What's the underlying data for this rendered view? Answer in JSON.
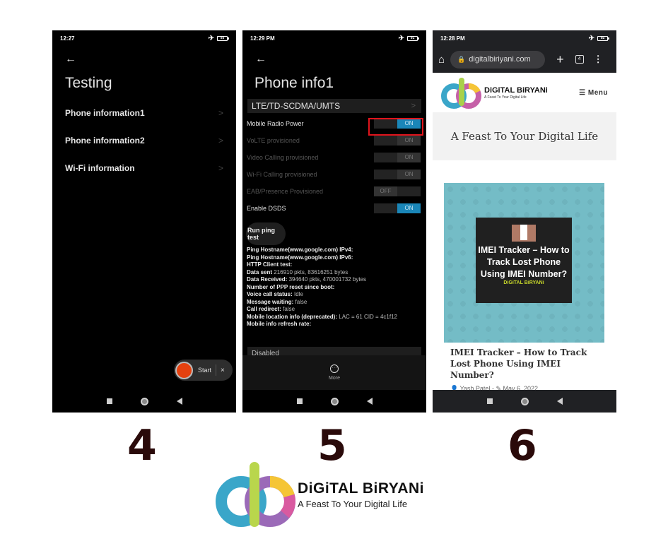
{
  "screens": {
    "testing": {
      "status_time": "12:27",
      "battery": "93",
      "title": "Testing",
      "items": [
        {
          "label": "Phone information1"
        },
        {
          "label": "Phone information2"
        },
        {
          "label": "Wi-Fi information"
        }
      ],
      "recorder": {
        "start_label": "Start",
        "close_label": "×"
      }
    },
    "phone_info": {
      "status_time": "12:29 PM",
      "battery": "91",
      "title": "Phone info1",
      "network_type": "LTE/TD-SCDMA/UMTS",
      "toggles": [
        {
          "label": "Mobile Radio Power",
          "state": "ON",
          "enabled": true
        },
        {
          "label": "VoLTE provisioned",
          "state": "ON",
          "enabled": false
        },
        {
          "label": "Video Calling provisioned",
          "state": "ON",
          "enabled": false
        },
        {
          "label": "Wi-Fi Calling provisioned",
          "state": "ON",
          "enabled": false
        },
        {
          "label": "EAB/Presence Provisioned",
          "state": "OFF",
          "enabled": false
        },
        {
          "label": "Enable DSDS",
          "state": "ON",
          "enabled": true
        }
      ],
      "ping_button": "Run ping test",
      "info": [
        {
          "key": "Ping Hostname(www.google.com) IPv4:",
          "value": ""
        },
        {
          "key": "Ping Hostname(www.google.com) IPv6:",
          "value": ""
        },
        {
          "key": "HTTP Client test:",
          "value": ""
        },
        {
          "key": "Data sent",
          "value": "216910 pkts, 83616251 bytes"
        },
        {
          "key": "Data Received:",
          "value": "394640 pkts, 470001732 bytes"
        },
        {
          "key": "Number of PPP reset since boot:",
          "value": ""
        },
        {
          "key": "Voice call status:",
          "value": "Idle"
        },
        {
          "key": "Message waiting:",
          "value": "false"
        },
        {
          "key": "Call redirect:",
          "value": "false"
        },
        {
          "key": "Mobile location info (deprecated):",
          "value": "LAC = 61   CID = 4c1f12"
        },
        {
          "key": "Mobile info refresh rate:",
          "value": ""
        }
      ],
      "refresh_value": "Disabled",
      "more_label": "More"
    },
    "browser": {
      "status_time": "12:28 PM",
      "battery": "92",
      "url": "digitalbiriyani.com",
      "tab_count": "4",
      "brand_name": "DiGiTAL BiRYANi",
      "brand_tagline": "A Feast To Your Digital Life",
      "menu_label": "Menu",
      "hero_text": "A Feast To Your Digital Life",
      "article": {
        "image_title": "IMEI Tracker – How to Track Lost Phone Using IMEI Number?",
        "image_watermark": "DiGiTAL BiRYANi",
        "title": "IMEI Tracker – How to Track Lost Phone Using IMEI Number?",
        "author": "Yash Patel",
        "date": "May 6, 2022"
      }
    }
  },
  "steps": [
    "4",
    "5",
    "6"
  ],
  "footer": {
    "brand_name": "DiGiTAL BiRYANi",
    "tagline": "A Feast To Your Digital Life"
  },
  "colors": {
    "toggle_on": "#1a86b8",
    "highlight": "#e1141c",
    "record": "#e5410f",
    "step_number": "#2a0a0a"
  }
}
